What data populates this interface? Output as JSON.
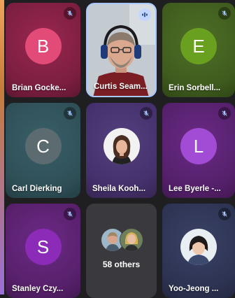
{
  "colors": {
    "accent": "#f0a35a",
    "mic_off": "#a5c8ff",
    "speaking_badge": "#c2d6ff"
  },
  "tiles": [
    {
      "name": "Brian Gocke...",
      "initial": "B",
      "type": "avatar",
      "mic": "muted",
      "tile_bg": "#7b1e3f",
      "avatar_color": "#e24b78"
    },
    {
      "name": "Curtis Seam...",
      "initial": "",
      "type": "video",
      "mic": "speaking",
      "tile_bg": "#bfc6cc",
      "avatar_color": ""
    },
    {
      "name": "Erin Sorbell...",
      "initial": "E",
      "type": "avatar",
      "mic": "muted",
      "tile_bg": "#3f5b1e",
      "avatar_color": "#6aa020"
    },
    {
      "name": "Carl Dierking",
      "initial": "C",
      "type": "avatar",
      "mic": "muted",
      "tile_bg": "#2f4f57",
      "avatar_color": "#5b6b70"
    },
    {
      "name": "Sheila Kooh...",
      "initial": "",
      "type": "photo",
      "mic": "muted",
      "tile_bg": "#44306b",
      "avatar_color": ""
    },
    {
      "name": "Lee Byerle -...",
      "initial": "L",
      "type": "avatar",
      "mic": "muted",
      "tile_bg": "#55206b",
      "avatar_color": "#a24bd4"
    },
    {
      "name": "Stanley Czy...",
      "initial": "S",
      "type": "avatar",
      "mic": "muted",
      "tile_bg": "#57206b",
      "avatar_color": "#8c2bb8"
    },
    {
      "name": "",
      "initial": "",
      "type": "others",
      "mic": "none",
      "tile_bg": "#3a3a3e",
      "avatar_color": ""
    },
    {
      "name": "Yoo-Jeong ...",
      "initial": "",
      "type": "photo",
      "mic": "muted",
      "tile_bg": "#2d3352",
      "avatar_color": ""
    }
  ],
  "others": {
    "label": "58 others"
  },
  "icons": {
    "mic_muted": "mic-off-icon",
    "speaking": "audio-level-icon"
  }
}
